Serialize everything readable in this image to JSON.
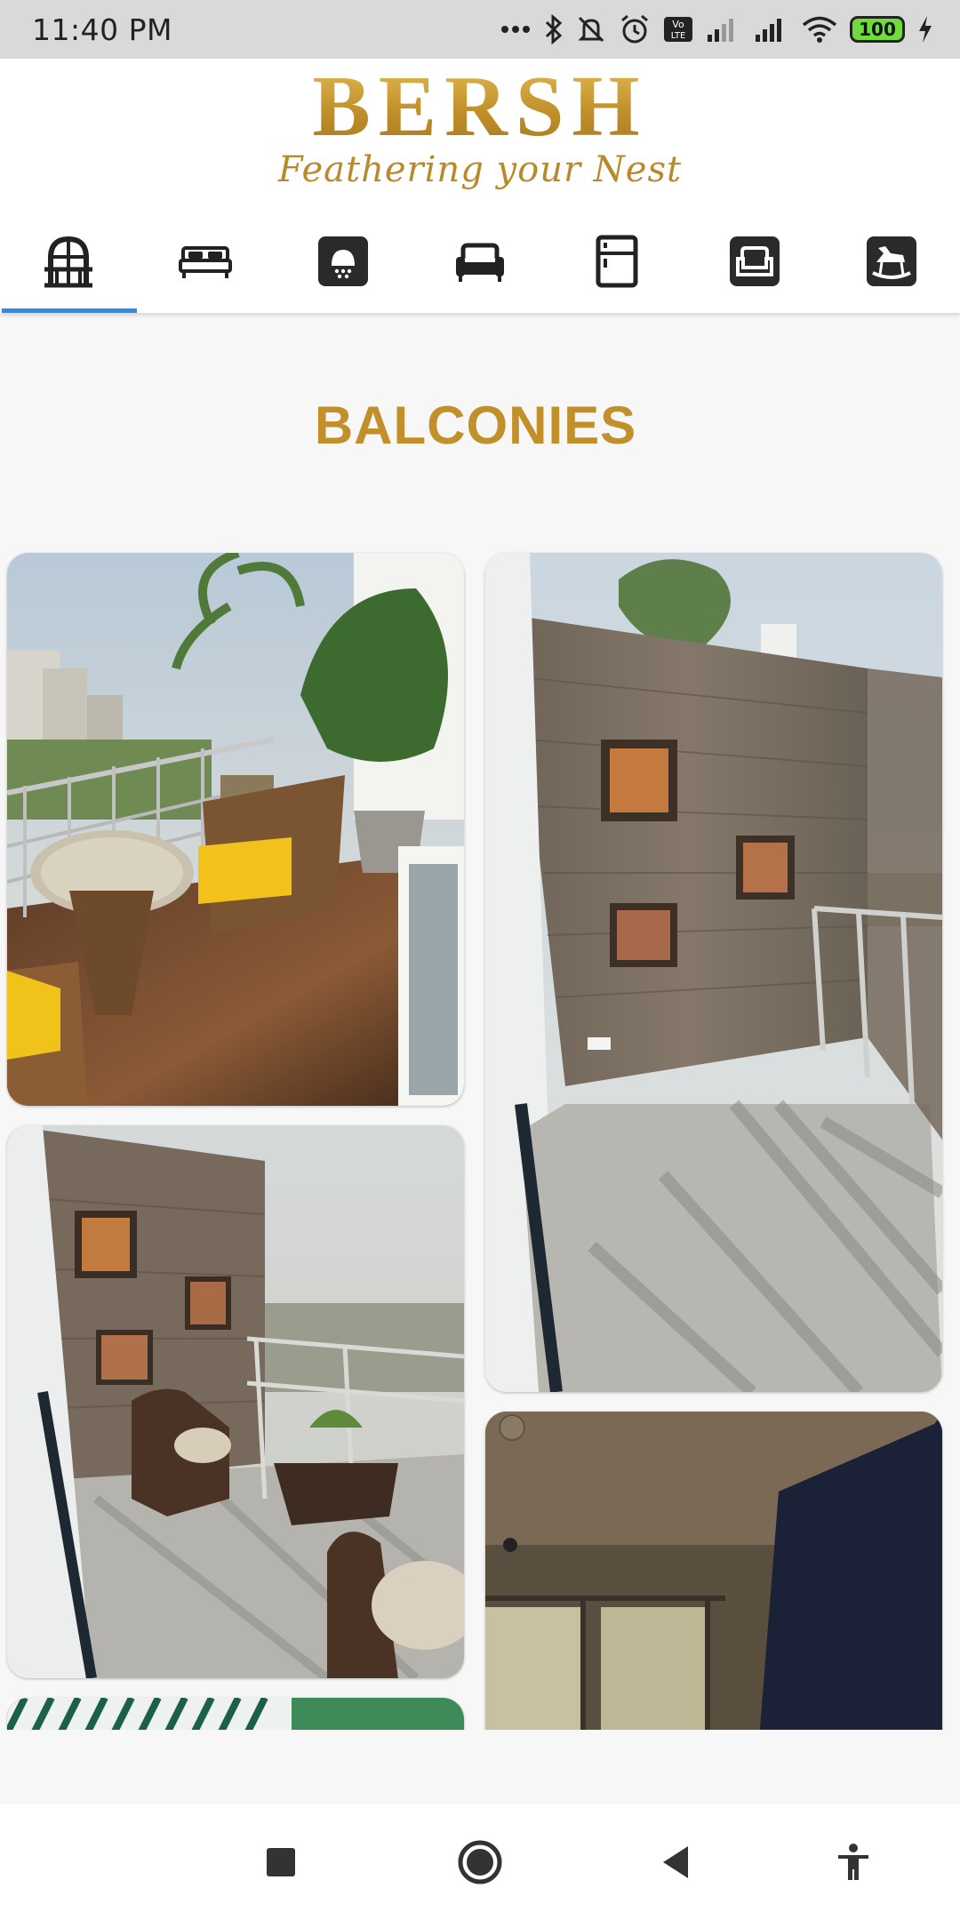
{
  "status_bar": {
    "time": "11:40 PM",
    "battery": "100",
    "icons": [
      "more-dots-icon",
      "bluetooth-icon",
      "mute-icon",
      "alarm-icon",
      "volte-icon",
      "signal-icon",
      "signal-icon",
      "wifi-icon",
      "battery-icon",
      "charging-icon"
    ]
  },
  "brand": {
    "name": "BERSH",
    "tagline": "Feathering your Nest",
    "gold": "#c1902a"
  },
  "tabs": [
    {
      "icon": "balcony-icon",
      "active": true
    },
    {
      "icon": "bed-icon",
      "active": false
    },
    {
      "icon": "lamp-icon",
      "active": false
    },
    {
      "icon": "sofa-icon",
      "active": false
    },
    {
      "icon": "wardrobe-icon",
      "active": false
    },
    {
      "icon": "armchair-icon",
      "active": false
    },
    {
      "icon": "rocking-horse-icon",
      "active": false
    }
  ],
  "page": {
    "title": "BALCONIES",
    "accent_underline": "#2f8be8"
  },
  "gallery": [
    {
      "subject": "balcony-photo"
    },
    {
      "subject": "balcony-photo"
    },
    {
      "subject": "balcony-photo"
    },
    {
      "subject": "balcony-photo"
    },
    {
      "subject": "balcony-photo"
    }
  ],
  "system_nav": [
    "recent-apps-icon",
    "home-icon",
    "back-icon",
    "accessibility-icon"
  ]
}
